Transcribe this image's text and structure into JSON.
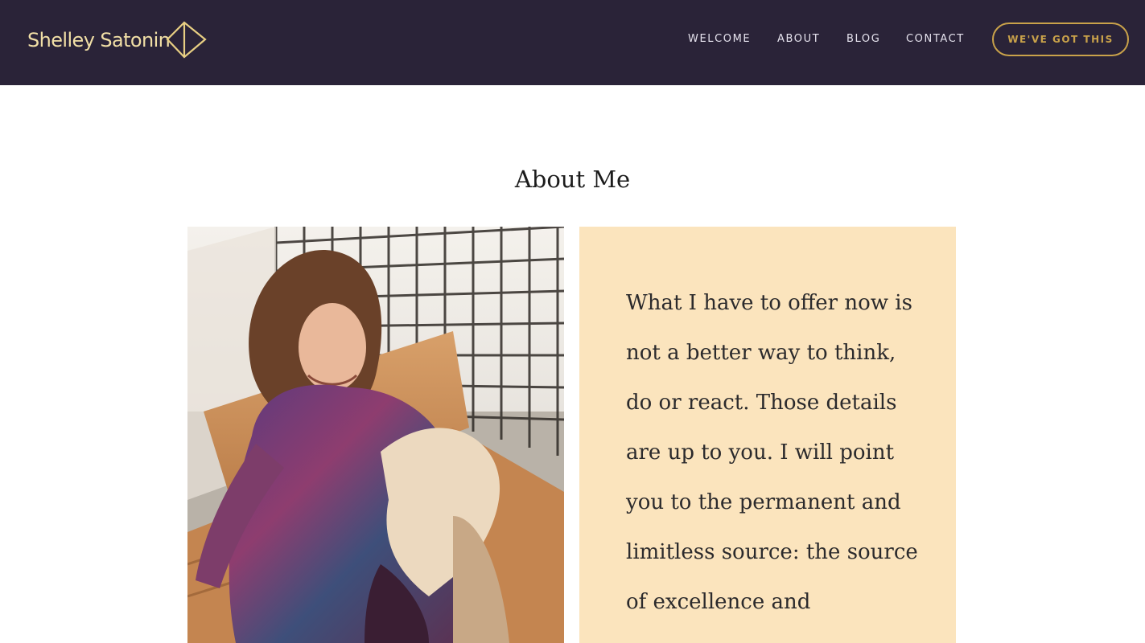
{
  "header": {
    "brand_name": "Shelley Satonin",
    "nav": [
      {
        "label": "WELCOME"
      },
      {
        "label": "ABOUT"
      },
      {
        "label": "BLOG"
      },
      {
        "label": "CONTACT"
      }
    ],
    "cta_label": "WE'VE GOT THIS"
  },
  "about": {
    "title": "About Me",
    "quote": "What I have to offer now is not a better way to think, do or react. Those details are up to you. I will point you to the permanent and limitless source: the source of excellence and"
  },
  "colors": {
    "header_bg": "#2a2338",
    "brand_gold": "#c9a24a",
    "brand_text": "#f1dfa6",
    "quote_card_bg": "#fbe4bd",
    "page_bg": "#ffffff"
  },
  "icons": {
    "brand_mark": "diamond-logo-icon"
  }
}
